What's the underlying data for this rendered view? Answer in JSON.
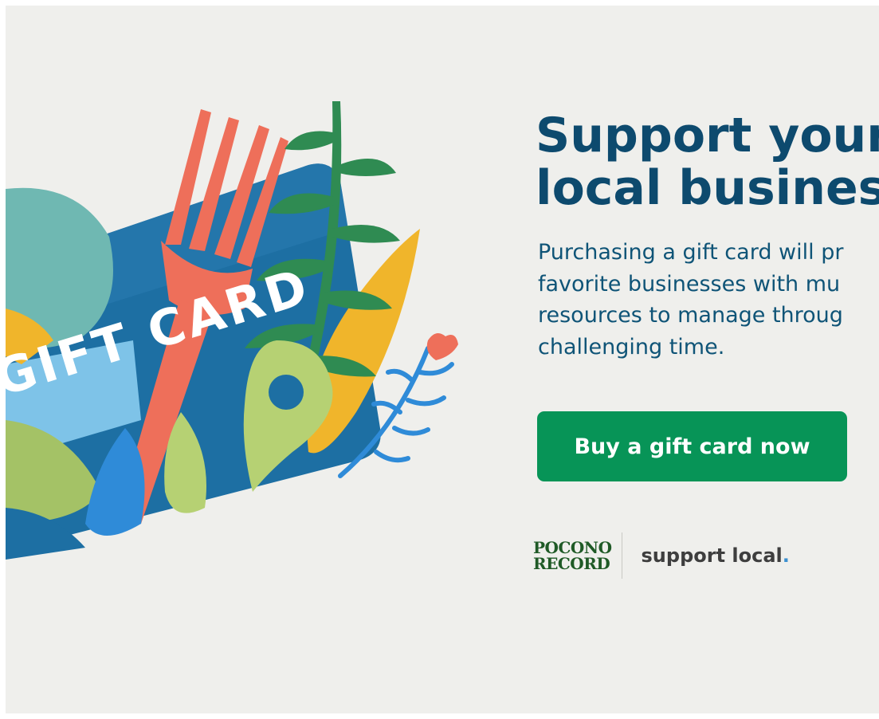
{
  "banner": {
    "headline_lines": [
      "Support your",
      "local business"
    ],
    "body_lines": [
      "Purchasing a gift card will pr",
      "favorite businesses with mu",
      "resources to manage throug",
      "challenging time."
    ],
    "cta_label": "Buy a gift card now",
    "card_text": "GIFT CARD",
    "publisher_lines": [
      "POCONO",
      "RECORD"
    ],
    "tagline_text": "support local",
    "tagline_dot": "."
  },
  "colors": {
    "background": "#efefec",
    "headline": "#0d4a6e",
    "body": "#0f5477",
    "cta": "#079457",
    "publisher": "#1f5a26",
    "tagline": "#3e3e3e",
    "tagline_dot": "#3a8fd0"
  }
}
